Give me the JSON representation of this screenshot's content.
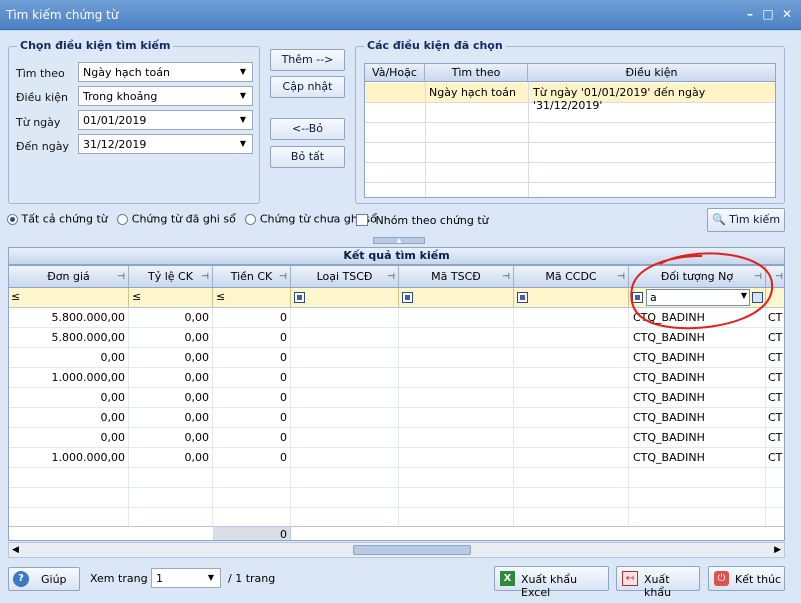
{
  "window": {
    "title": "Tìm kiếm chứng từ"
  },
  "criteria": {
    "title": "Chọn điều kiện tìm kiếm",
    "search_by_label": "Tìm theo",
    "search_by_value": "Ngày hạch toán",
    "condition_label": "Điều kiện",
    "condition_value": "Trong khoảng",
    "from_label": "Từ ngày",
    "from_value": "01/01/2019",
    "to_label": "Đến ngày",
    "to_value": "31/12/2019"
  },
  "buttons": {
    "add": "Thêm -->",
    "update": "Cập nhật",
    "remove": "<--Bỏ",
    "remove_all": "Bỏ tất",
    "search": "Tìm kiếm"
  },
  "selected": {
    "title": "Các điều kiện đã chọn",
    "headers": [
      "Và/Hoặc",
      "Tìm theo",
      "Điều kiện"
    ],
    "rows": [
      {
        "and_or": "",
        "field": "Ngày hạch toán",
        "condition": "Từ ngày '01/01/2019' đến ngày '31/12/2019'"
      }
    ]
  },
  "filters": {
    "all": "Tất cả chứng từ",
    "posted": "Chứng từ đã ghi sổ",
    "unposted": "Chứng từ chưa ghi sổ",
    "group": "Nhóm theo chứng từ",
    "selected": "all"
  },
  "results": {
    "title": "Kết quả tìm kiếm",
    "headers": [
      "Đơn giá",
      "Tỷ lệ CK",
      "Tiền CK",
      "Loại TSCĐ",
      "Mã TSCĐ",
      "Mã CCDC",
      "Đối tượng Nợ"
    ],
    "filter_ops": [
      "≤",
      "≤",
      "≤"
    ],
    "debtor_filter_value": "a",
    "rows": [
      [
        "5.800.000,00",
        "0,00",
        "0",
        "",
        "",
        "",
        "CTQ_BADINH",
        "CT"
      ],
      [
        "5.800.000,00",
        "0,00",
        "0",
        "",
        "",
        "",
        "CTQ_BADINH",
        "CT"
      ],
      [
        "0,00",
        "0,00",
        "0",
        "",
        "",
        "",
        "CTQ_BADINH",
        "CT"
      ],
      [
        "1.000.000,00",
        "0,00",
        "0",
        "",
        "",
        "",
        "CTQ_BADINH",
        "CT"
      ],
      [
        "0,00",
        "0,00",
        "0",
        "",
        "",
        "",
        "CTQ_BADINH",
        "CT"
      ],
      [
        "0,00",
        "0,00",
        "0",
        "",
        "",
        "",
        "CTQ_BADINH",
        "CT"
      ],
      [
        "0,00",
        "0,00",
        "0",
        "",
        "",
        "",
        "CTQ_BADINH",
        "CT"
      ],
      [
        "1.000.000,00",
        "0,00",
        "0",
        "",
        "",
        "",
        "CTQ_BADINH",
        "CT"
      ]
    ],
    "summary_value": "0"
  },
  "footer": {
    "help": "Giúp",
    "view_page_label": "Xem trang",
    "page_value": "1",
    "page_total": "/ 1 trang",
    "export_excel": "Xuất khẩu Excel",
    "export": "Xuất khẩu",
    "finish": "Kết thúc"
  },
  "colors": {
    "titlebar": "#5a8cc9",
    "annotation_circle": "#e0201a",
    "selected_row": "#fff4c8",
    "filter_row": "#fff6cc"
  }
}
